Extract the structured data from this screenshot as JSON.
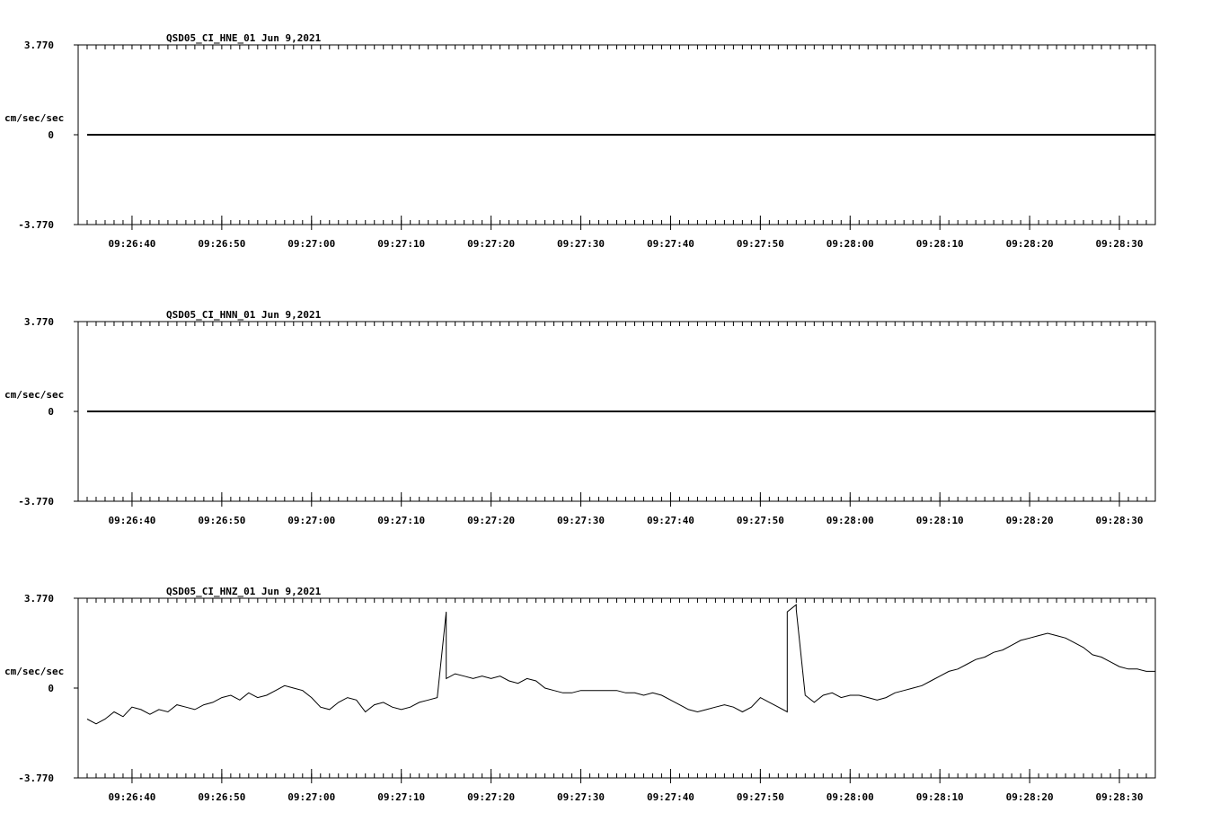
{
  "chart_data": [
    {
      "type": "line",
      "title": "QSD05_CI_HNE_01  Jun 9,2021",
      "ylabel": "cm/sec/sec",
      "ytick_labels": [
        "3.770",
        "0",
        "-3.770"
      ],
      "ylim": [
        -3.77,
        3.77
      ],
      "xlim": [
        "09:26:34",
        "09:28:34"
      ],
      "xtick_labels": [
        "09:26:40",
        "09:26:50",
        "09:27:00",
        "09:27:10",
        "09:27:20",
        "09:27:30",
        "09:27:40",
        "09:27:50",
        "09:28:00",
        "09:28:10",
        "09:28:20",
        "09:28:30"
      ],
      "x": [
        "09:26:35",
        "09:28:34"
      ],
      "values": [
        0,
        0
      ]
    },
    {
      "type": "line",
      "title": "QSD05_CI_HNN_01  Jun 9,2021",
      "ylabel": "cm/sec/sec",
      "ytick_labels": [
        "3.770",
        "0",
        "-3.770"
      ],
      "ylim": [
        -3.77,
        3.77
      ],
      "xlim": [
        "09:26:34",
        "09:28:34"
      ],
      "xtick_labels": [
        "09:26:40",
        "09:26:50",
        "09:27:00",
        "09:27:10",
        "09:27:20",
        "09:27:30",
        "09:27:40",
        "09:27:50",
        "09:28:00",
        "09:28:10",
        "09:28:20",
        "09:28:30"
      ],
      "x": [
        "09:26:35",
        "09:28:34"
      ],
      "values": [
        0,
        0
      ]
    },
    {
      "type": "line",
      "title": "QSD05_CI_HNZ_01  Jun 9,2021",
      "ylabel": "cm/sec/sec",
      "ytick_labels": [
        "3.770",
        "0",
        "-3.770"
      ],
      "ylim": [
        -3.77,
        3.77
      ],
      "xlim": [
        "09:26:34",
        "09:28:34"
      ],
      "xtick_labels": [
        "09:26:40",
        "09:26:50",
        "09:27:00",
        "09:27:10",
        "09:27:20",
        "09:27:30",
        "09:27:40",
        "09:27:50",
        "09:28:00",
        "09:28:10",
        "09:28:20",
        "09:28:30"
      ],
      "x": [
        "09:26:35",
        "09:26:36",
        "09:26:37",
        "09:26:38",
        "09:26:39",
        "09:26:40",
        "09:26:41",
        "09:26:42",
        "09:26:43",
        "09:26:44",
        "09:26:45",
        "09:26:46",
        "09:26:47",
        "09:26:48",
        "09:26:49",
        "09:26:50",
        "09:26:51",
        "09:26:52",
        "09:26:53",
        "09:26:54",
        "09:26:55",
        "09:26:56",
        "09:26:57",
        "09:26:58",
        "09:26:59",
        "09:27:00",
        "09:27:01",
        "09:27:02",
        "09:27:03",
        "09:27:04",
        "09:27:05",
        "09:27:06",
        "09:27:07",
        "09:27:08",
        "09:27:09",
        "09:27:10",
        "09:27:11",
        "09:27:12",
        "09:27:13",
        "09:27:14",
        "09:27:15",
        "09:27:15",
        "09:27:16",
        "09:27:17",
        "09:27:18",
        "09:27:19",
        "09:27:20",
        "09:27:21",
        "09:27:22",
        "09:27:23",
        "09:27:24",
        "09:27:25",
        "09:27:26",
        "09:27:27",
        "09:27:28",
        "09:27:29",
        "09:27:30",
        "09:27:31",
        "09:27:32",
        "09:27:33",
        "09:27:34",
        "09:27:35",
        "09:27:36",
        "09:27:37",
        "09:27:38",
        "09:27:39",
        "09:27:40",
        "09:27:41",
        "09:27:42",
        "09:27:43",
        "09:27:44",
        "09:27:45",
        "09:27:46",
        "09:27:47",
        "09:27:48",
        "09:27:49",
        "09:27:50",
        "09:27:51",
        "09:27:52",
        "09:27:53",
        "09:27:53",
        "09:27:54",
        "09:27:54",
        "09:27:55",
        "09:27:56",
        "09:27:57",
        "09:27:58",
        "09:27:59",
        "09:28:00",
        "09:28:01",
        "09:28:02",
        "09:28:03",
        "09:28:04",
        "09:28:05",
        "09:28:06",
        "09:28:07",
        "09:28:08",
        "09:28:09",
        "09:28:10",
        "09:28:11",
        "09:28:12",
        "09:28:13",
        "09:28:14",
        "09:28:15",
        "09:28:16",
        "09:28:17",
        "09:28:18",
        "09:28:19",
        "09:28:20",
        "09:28:21",
        "09:28:22",
        "09:28:23",
        "09:28:24",
        "09:28:25",
        "09:28:26",
        "09:28:27",
        "09:28:28",
        "09:28:29",
        "09:28:30",
        "09:28:31",
        "09:28:32",
        "09:28:33",
        "09:28:34"
      ],
      "values": [
        -1.3,
        -1.5,
        -1.3,
        -1.0,
        -1.2,
        -0.8,
        -0.9,
        -1.1,
        -0.9,
        -1.0,
        -0.7,
        -0.8,
        -0.9,
        -0.7,
        -0.6,
        -0.4,
        -0.3,
        -0.5,
        -0.2,
        -0.4,
        -0.3,
        -0.1,
        0.1,
        0.0,
        -0.1,
        -0.4,
        -0.8,
        -0.9,
        -0.6,
        -0.4,
        -0.5,
        -1.0,
        -0.7,
        -0.6,
        -0.8,
        -0.9,
        -0.8,
        -0.6,
        -0.5,
        -0.4,
        3.2,
        0.4,
        0.6,
        0.5,
        0.4,
        0.5,
        0.4,
        0.5,
        0.3,
        0.2,
        0.4,
        0.3,
        0.0,
        -0.1,
        -0.2,
        -0.2,
        -0.1,
        -0.1,
        -0.1,
        -0.1,
        -0.1,
        -0.2,
        -0.2,
        -0.3,
        -0.2,
        -0.3,
        -0.5,
        -0.7,
        -0.9,
        -1.0,
        -0.9,
        -0.8,
        -0.7,
        -0.8,
        -1.0,
        -0.8,
        -0.4,
        -0.6,
        -0.8,
        -1.0,
        3.2,
        3.5,
        3.3,
        -0.3,
        -0.6,
        -0.3,
        -0.2,
        -0.4,
        -0.3,
        -0.3,
        -0.4,
        -0.5,
        -0.4,
        -0.2,
        -0.1,
        0.0,
        0.1,
        0.3,
        0.5,
        0.7,
        0.8,
        1.0,
        1.2,
        1.3,
        1.5,
        1.6,
        1.8,
        2.0,
        2.1,
        2.2,
        2.3,
        2.2,
        2.1,
        1.9,
        1.7,
        1.4,
        1.3,
        1.1,
        0.9,
        0.8,
        0.8,
        0.7,
        0.7,
        0.8,
        0.8,
        0.9,
        0.9,
        0.8
      ]
    }
  ]
}
